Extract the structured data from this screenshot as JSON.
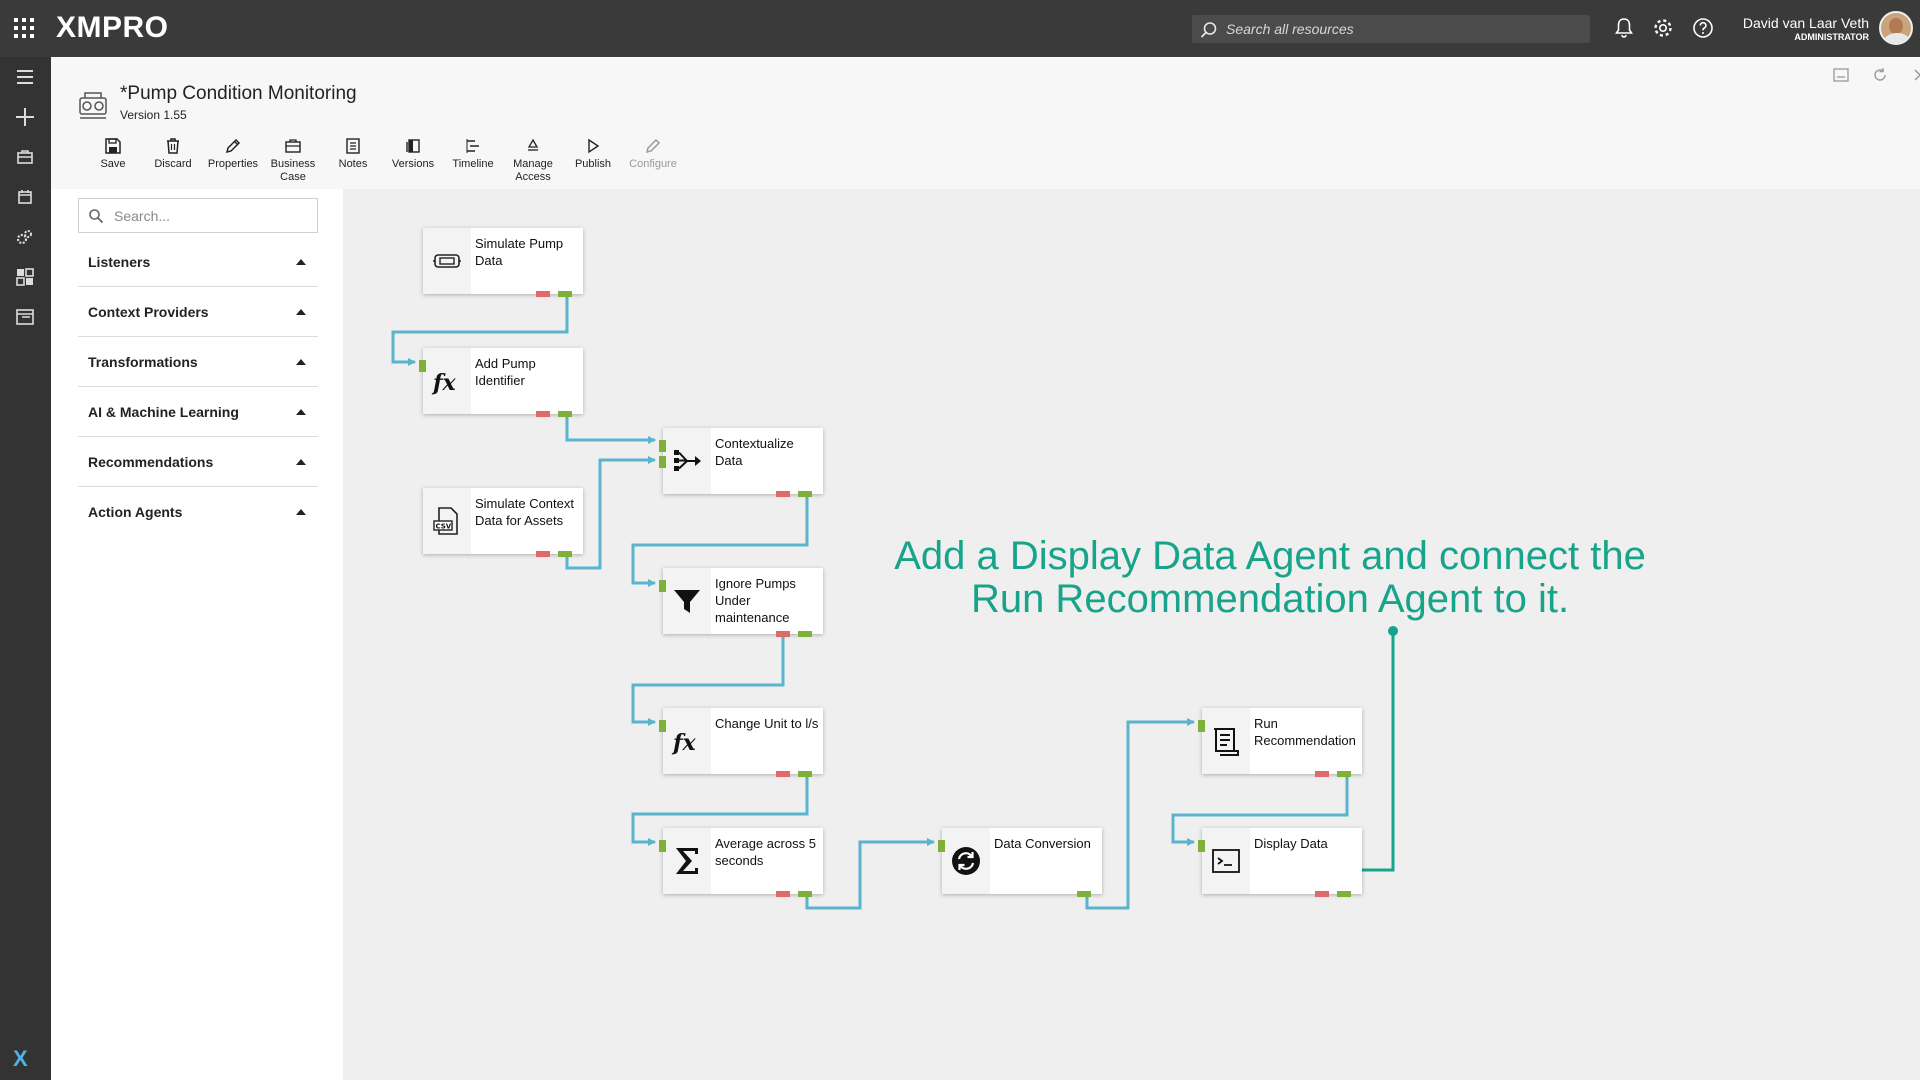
{
  "topbar": {
    "brand": "XMPRO",
    "search_placeholder": "Search all resources",
    "user_name": "David van Laar Veth",
    "user_role": "ADMINISTRATOR"
  },
  "flow": {
    "title": "*Pump Condition Monitoring",
    "version": "Version 1.55"
  },
  "toolbar": [
    {
      "label_1": "Save",
      "label_2": "",
      "icon": "save-icon"
    },
    {
      "label_1": "Discard",
      "label_2": "",
      "icon": "trash-icon"
    },
    {
      "label_1": "Properties",
      "label_2": "",
      "icon": "pencil-icon"
    },
    {
      "label_1": "Business",
      "label_2": "Case",
      "icon": "briefcase-icon"
    },
    {
      "label_1": "Notes",
      "label_2": "",
      "icon": "notes-icon"
    },
    {
      "label_1": "Versions",
      "label_2": "",
      "icon": "versions-icon"
    },
    {
      "label_1": "Timeline",
      "label_2": "",
      "icon": "timeline-icon"
    },
    {
      "label_1": "Manage",
      "label_2": "Access",
      "icon": "recycle-icon"
    },
    {
      "label_1": "Publish",
      "label_2": "",
      "icon": "play-icon"
    },
    {
      "label_1": "Configure",
      "label_2": "",
      "icon": "pencil-icon",
      "disabled": true
    }
  ],
  "palette": {
    "search_placeholder": "Search...",
    "categories": [
      "Listeners",
      "Context Providers",
      "Transformations",
      "AI & Machine Learning",
      "Recommendations",
      "Action Agents"
    ]
  },
  "nodes": [
    {
      "id": "simulate-pump-data",
      "label_1": "Simulate Pump",
      "label_2": "Data",
      "label_3": "",
      "icon": "simulator-icon"
    },
    {
      "id": "add-pump-identifier",
      "label_1": "Add Pump",
      "label_2": "Identifier",
      "label_3": "",
      "icon": "function-icon"
    },
    {
      "id": "simulate-context-data",
      "label_1": "Simulate Context",
      "label_2": "Data for Assets",
      "label_3": "",
      "icon": "csv-file-icon"
    },
    {
      "id": "contextualize-data",
      "label_1": "Contextualize",
      "label_2": "Data",
      "label_3": "",
      "icon": "merge-icon"
    },
    {
      "id": "ignore-pumps",
      "label_1": "Ignore Pumps",
      "label_2": "Under",
      "label_3": "maintenance",
      "icon": "filter-icon"
    },
    {
      "id": "change-unit",
      "label_1": "Change Unit to l/s",
      "label_2": "",
      "label_3": "",
      "icon": "function-icon"
    },
    {
      "id": "average",
      "label_1": "Average across 5",
      "label_2": "seconds",
      "label_3": "",
      "icon": "sigma-icon"
    },
    {
      "id": "data-conversion",
      "label_1": "Data Conversion",
      "label_2": "",
      "label_3": "",
      "icon": "convert-icon"
    },
    {
      "id": "run-recommendation",
      "label_1": "Run",
      "label_2": "Recommendation",
      "label_3": "",
      "icon": "recommendation-icon"
    },
    {
      "id": "display-data",
      "label_1": "Display Data",
      "label_2": "",
      "label_3": "",
      "icon": "terminal-icon"
    }
  ],
  "instruction": {
    "line_1": "Add a Display Data Agent and connect the",
    "line_2": "Run Recommendation Agent to it."
  },
  "colors": {
    "wire": "#5ab4cf",
    "annotation": "#17a48a",
    "port_ok": "#7fb13a",
    "port_error": "#e06a6a"
  }
}
